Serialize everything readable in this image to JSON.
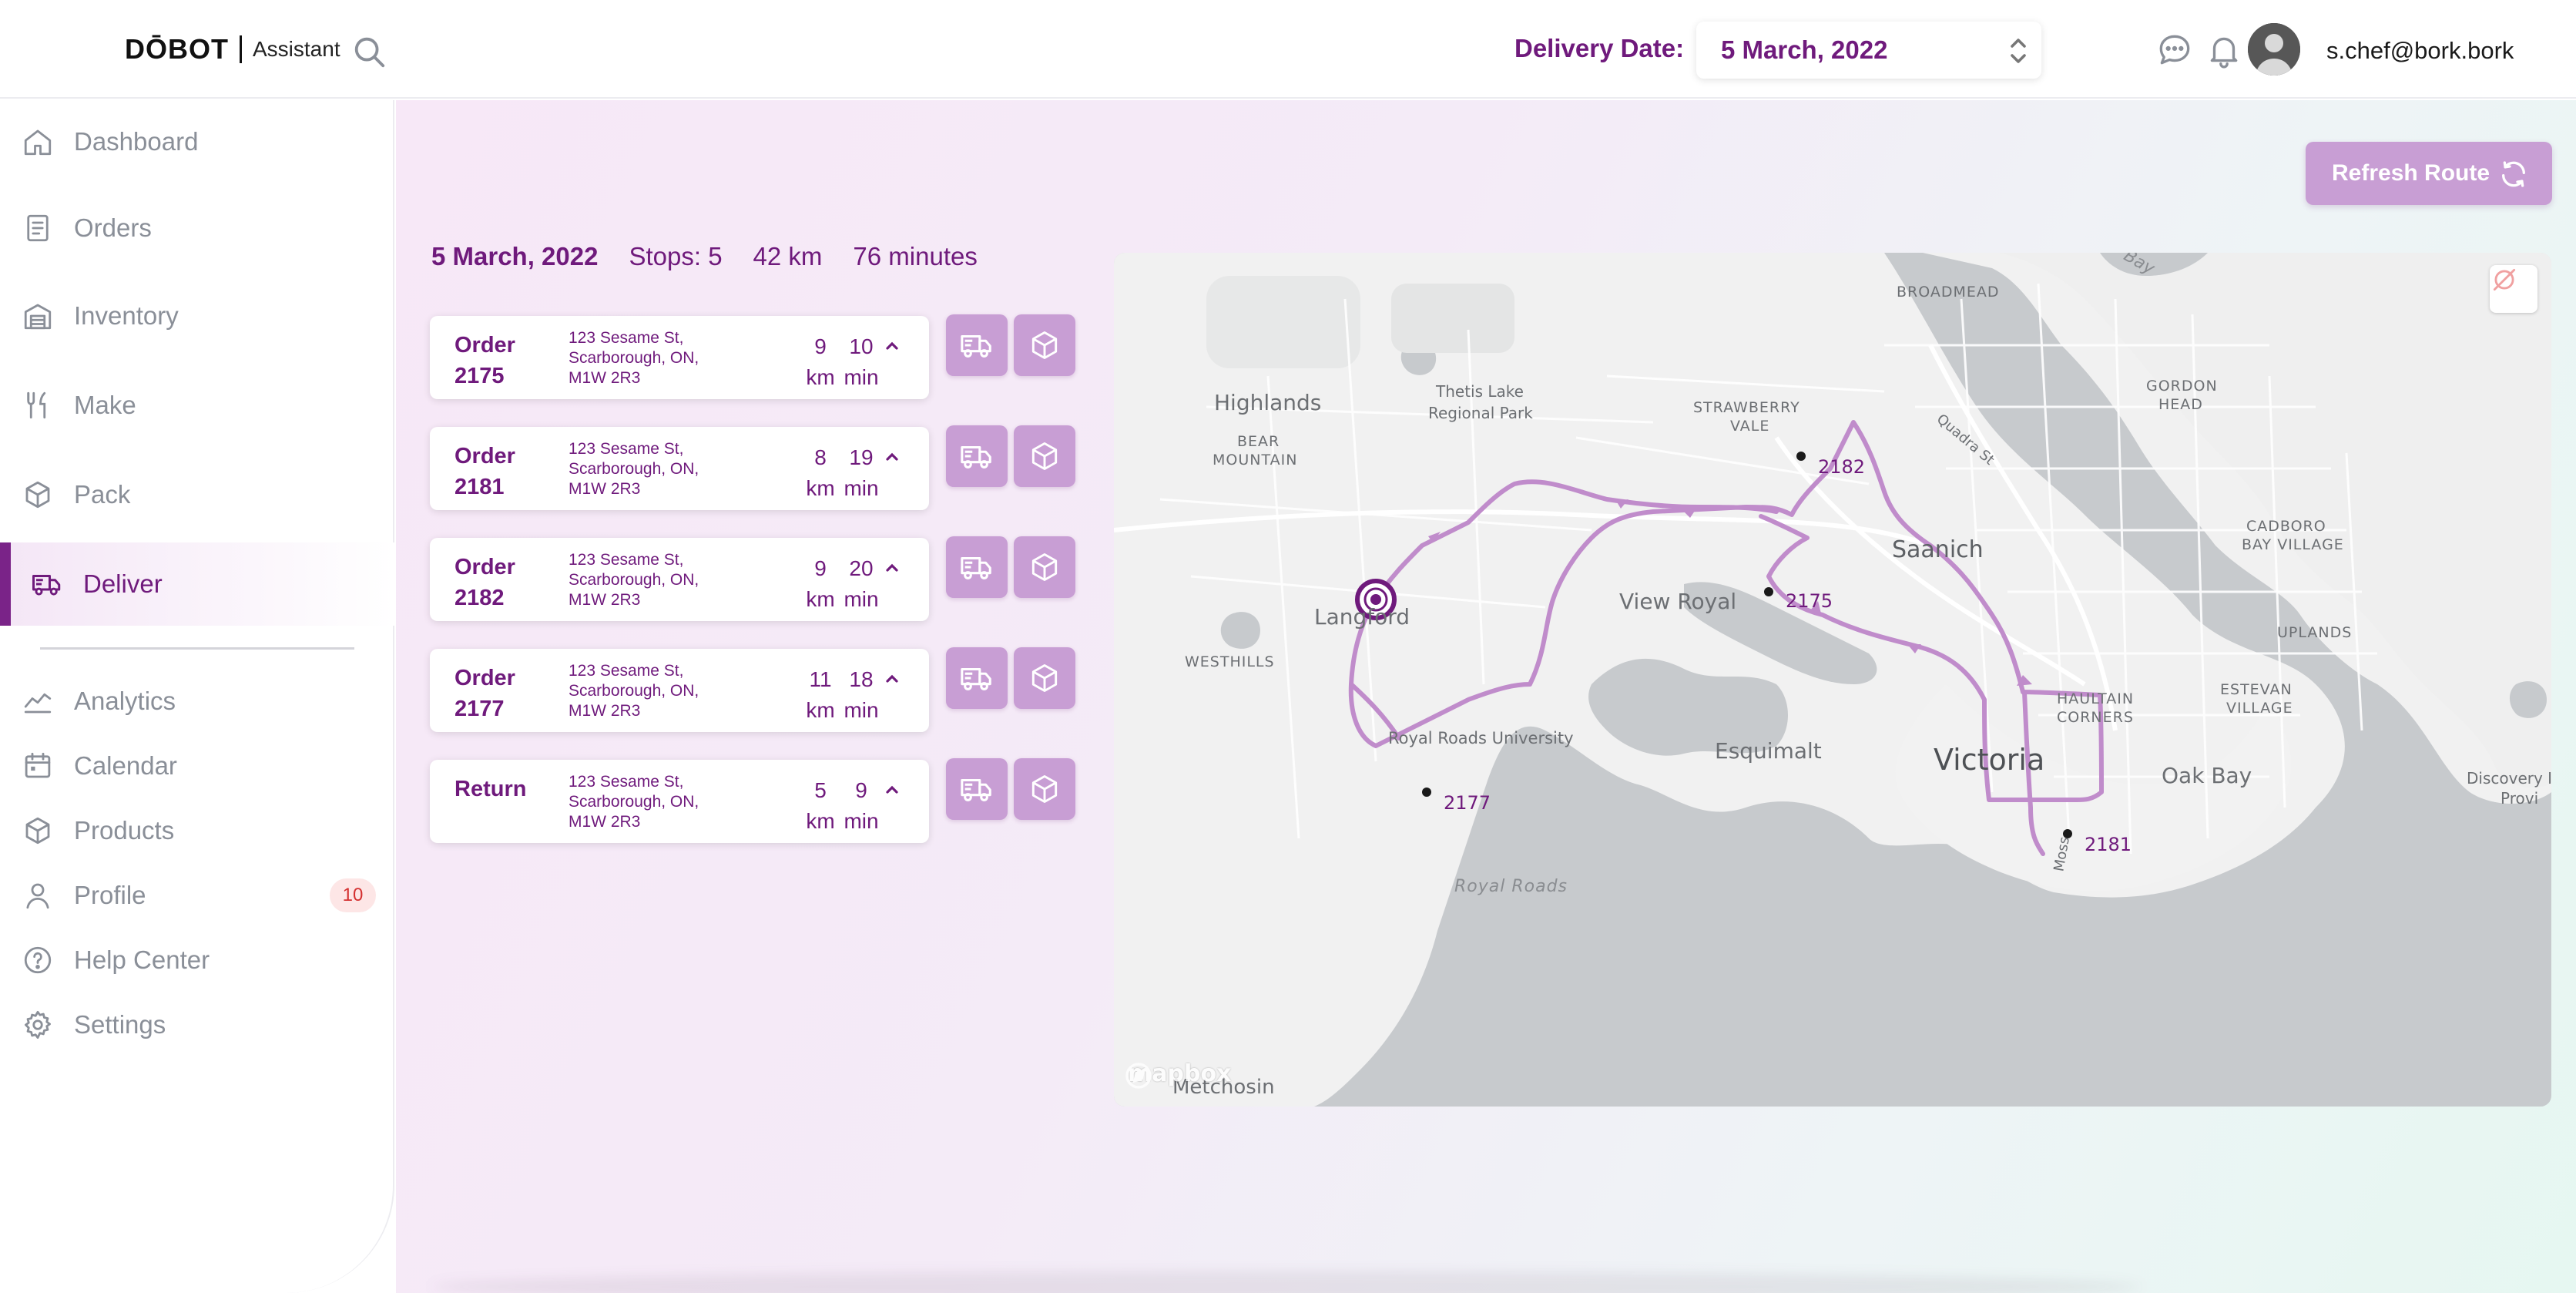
{
  "header": {
    "logo_brand": "DŌBOT",
    "logo_sub": "Assistant",
    "delivery_date_label": "Delivery Date:",
    "delivery_date_value": "5 March, 2022",
    "user_email": "s.chef@bork.bork"
  },
  "sidebar": {
    "items": [
      {
        "label": "Dashboard",
        "icon": "home-icon"
      },
      {
        "label": "Orders",
        "icon": "document-icon"
      },
      {
        "label": "Inventory",
        "icon": "warehouse-icon"
      },
      {
        "label": "Make",
        "icon": "kitchen-tools-icon"
      },
      {
        "label": "Pack",
        "icon": "box-icon"
      },
      {
        "label": "Deliver",
        "icon": "truck-icon",
        "active": true
      }
    ],
    "items2": [
      {
        "label": "Analytics",
        "icon": "chart-line-icon"
      },
      {
        "label": "Calendar",
        "icon": "calendar-icon"
      },
      {
        "label": "Products",
        "icon": "box-icon"
      },
      {
        "label": "Profile",
        "icon": "user-icon",
        "badge": "10"
      },
      {
        "label": "Help Center",
        "icon": "help-icon"
      },
      {
        "label": "Settings",
        "icon": "gear-icon"
      }
    ]
  },
  "main": {
    "refresh_label": "Refresh Route",
    "summary": {
      "date": "5 March, 2022",
      "stops": "Stops: 5",
      "distance": "42 km",
      "duration": "76 minutes"
    },
    "orders": [
      {
        "title": "Order 2175",
        "addr1": "123 Sesame St,",
        "addr2": "Scarborough, ON,",
        "addr3": "M1W 2R3",
        "dist": "9",
        "dist_unit": "km",
        "time": "10",
        "time_unit": "min"
      },
      {
        "title": "Order 2181",
        "addr1": "123 Sesame St,",
        "addr2": "Scarborough, ON,",
        "addr3": "M1W 2R3",
        "dist": "8",
        "dist_unit": "km",
        "time": "19",
        "time_unit": "min"
      },
      {
        "title": "Order 2182",
        "addr1": "123 Sesame St,",
        "addr2": "Scarborough, ON,",
        "addr3": "M1W 2R3",
        "dist": "9",
        "dist_unit": "km",
        "time": "20",
        "time_unit": "min"
      },
      {
        "title": "Order 2177",
        "addr1": "123 Sesame St,",
        "addr2": "Scarborough, ON,",
        "addr3": "M1W 2R3",
        "dist": "11",
        "dist_unit": "km",
        "time": "18",
        "time_unit": "min"
      },
      {
        "title": "Return",
        "addr1": "123 Sesame St,",
        "addr2": "Scarborough, ON,",
        "addr3": "M1W 2R3",
        "dist": "5",
        "dist_unit": "km",
        "time": "9",
        "time_unit": "min"
      }
    ]
  },
  "map": {
    "labels": {
      "highlands": "Highlands",
      "thetis1": "Thetis Lake",
      "thetis2": "Regional Park",
      "bear1": "BEAR",
      "bear2": "MOUNTAIN",
      "langford": "Langford",
      "westhills": "WESTHILLS",
      "view_royal": "View Royal",
      "strawberry1": "STRAWBERRY",
      "strawberry2": "VALE",
      "broadmead": "BROADMEAD",
      "quadra": "Quadra St",
      "gordon1": "GORDON",
      "gordon2": "HEAD",
      "saanich": "Saanich",
      "cadboro1": "CADBORO",
      "cadboro2": "BAY VILLAGE",
      "uplands": "UPLANDS",
      "haultain1": "HAULTAIN",
      "haultain2": "CORNERS",
      "estevan1": "ESTEVAN",
      "estevan2": "VILLAGE",
      "victoria": "Victoria",
      "oak_bay": "Oak Bay",
      "esquimalt": "Esquimalt",
      "royal_roads_univ": "Royal Roads University",
      "royal_roads": "Royal Roads",
      "discovery1": "Discovery I",
      "discovery2": "Provi",
      "bay": "Bay",
      "metchosin": "Metchosin",
      "moss": "Moss"
    },
    "stops": [
      "2182",
      "2175",
      "2177",
      "2181"
    ],
    "attribution": "mapbox",
    "route_color": "#c08ccb",
    "brand_color": "#6f1a7c"
  }
}
